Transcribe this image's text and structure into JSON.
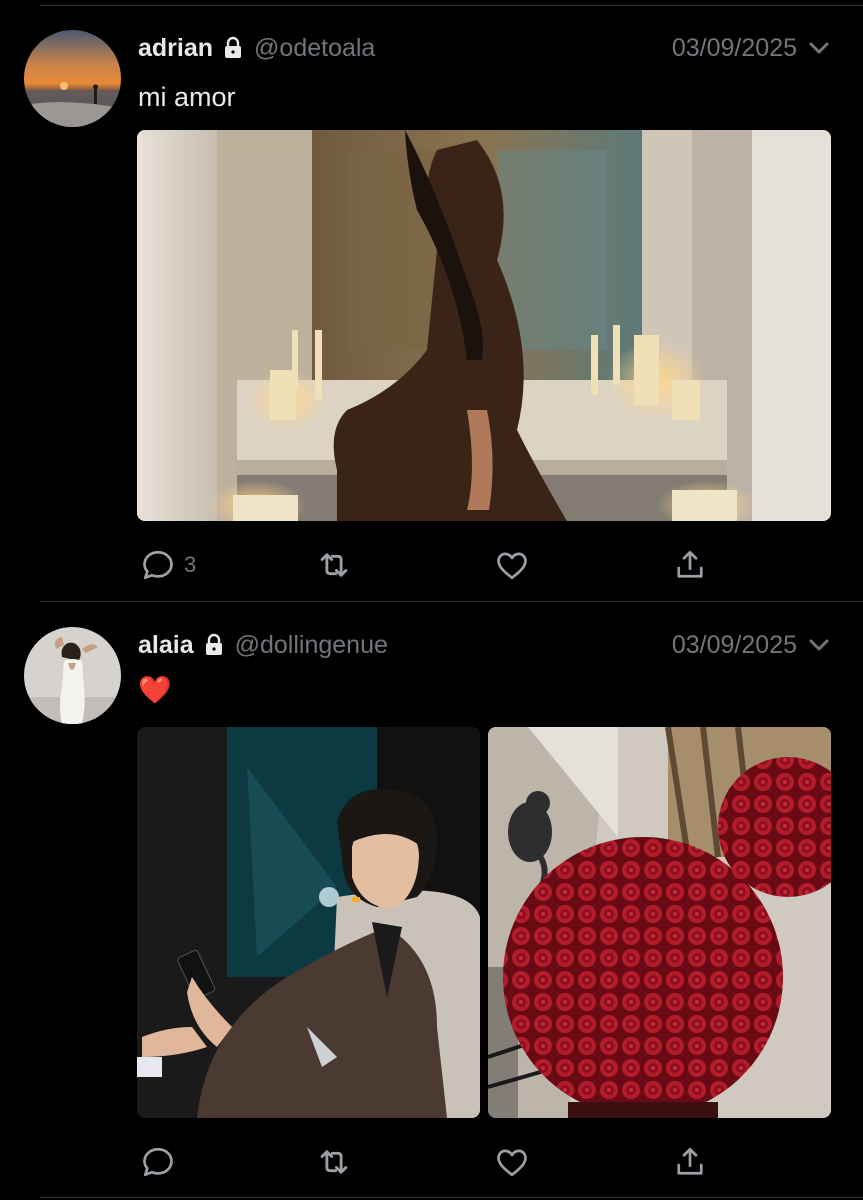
{
  "tweets": [
    {
      "name": "adrian",
      "handle": "@odetoala",
      "date": "03/09/2025",
      "text": "mi amor",
      "reply_count": "3"
    },
    {
      "name": "alaia",
      "handle": "@dollingenue",
      "date": "03/09/2025",
      "text": "❤️",
      "reply_count": ""
    }
  ],
  "icons": {
    "lock": "lock-icon",
    "chevron": "chevron-down-icon",
    "reply": "reply-icon",
    "retweet": "retweet-icon",
    "like": "heart-icon",
    "share": "share-icon"
  },
  "colors": {
    "background": "#000000",
    "text": "#e7e9ea",
    "secondary": "#71767b",
    "divider": "#2f3336"
  }
}
